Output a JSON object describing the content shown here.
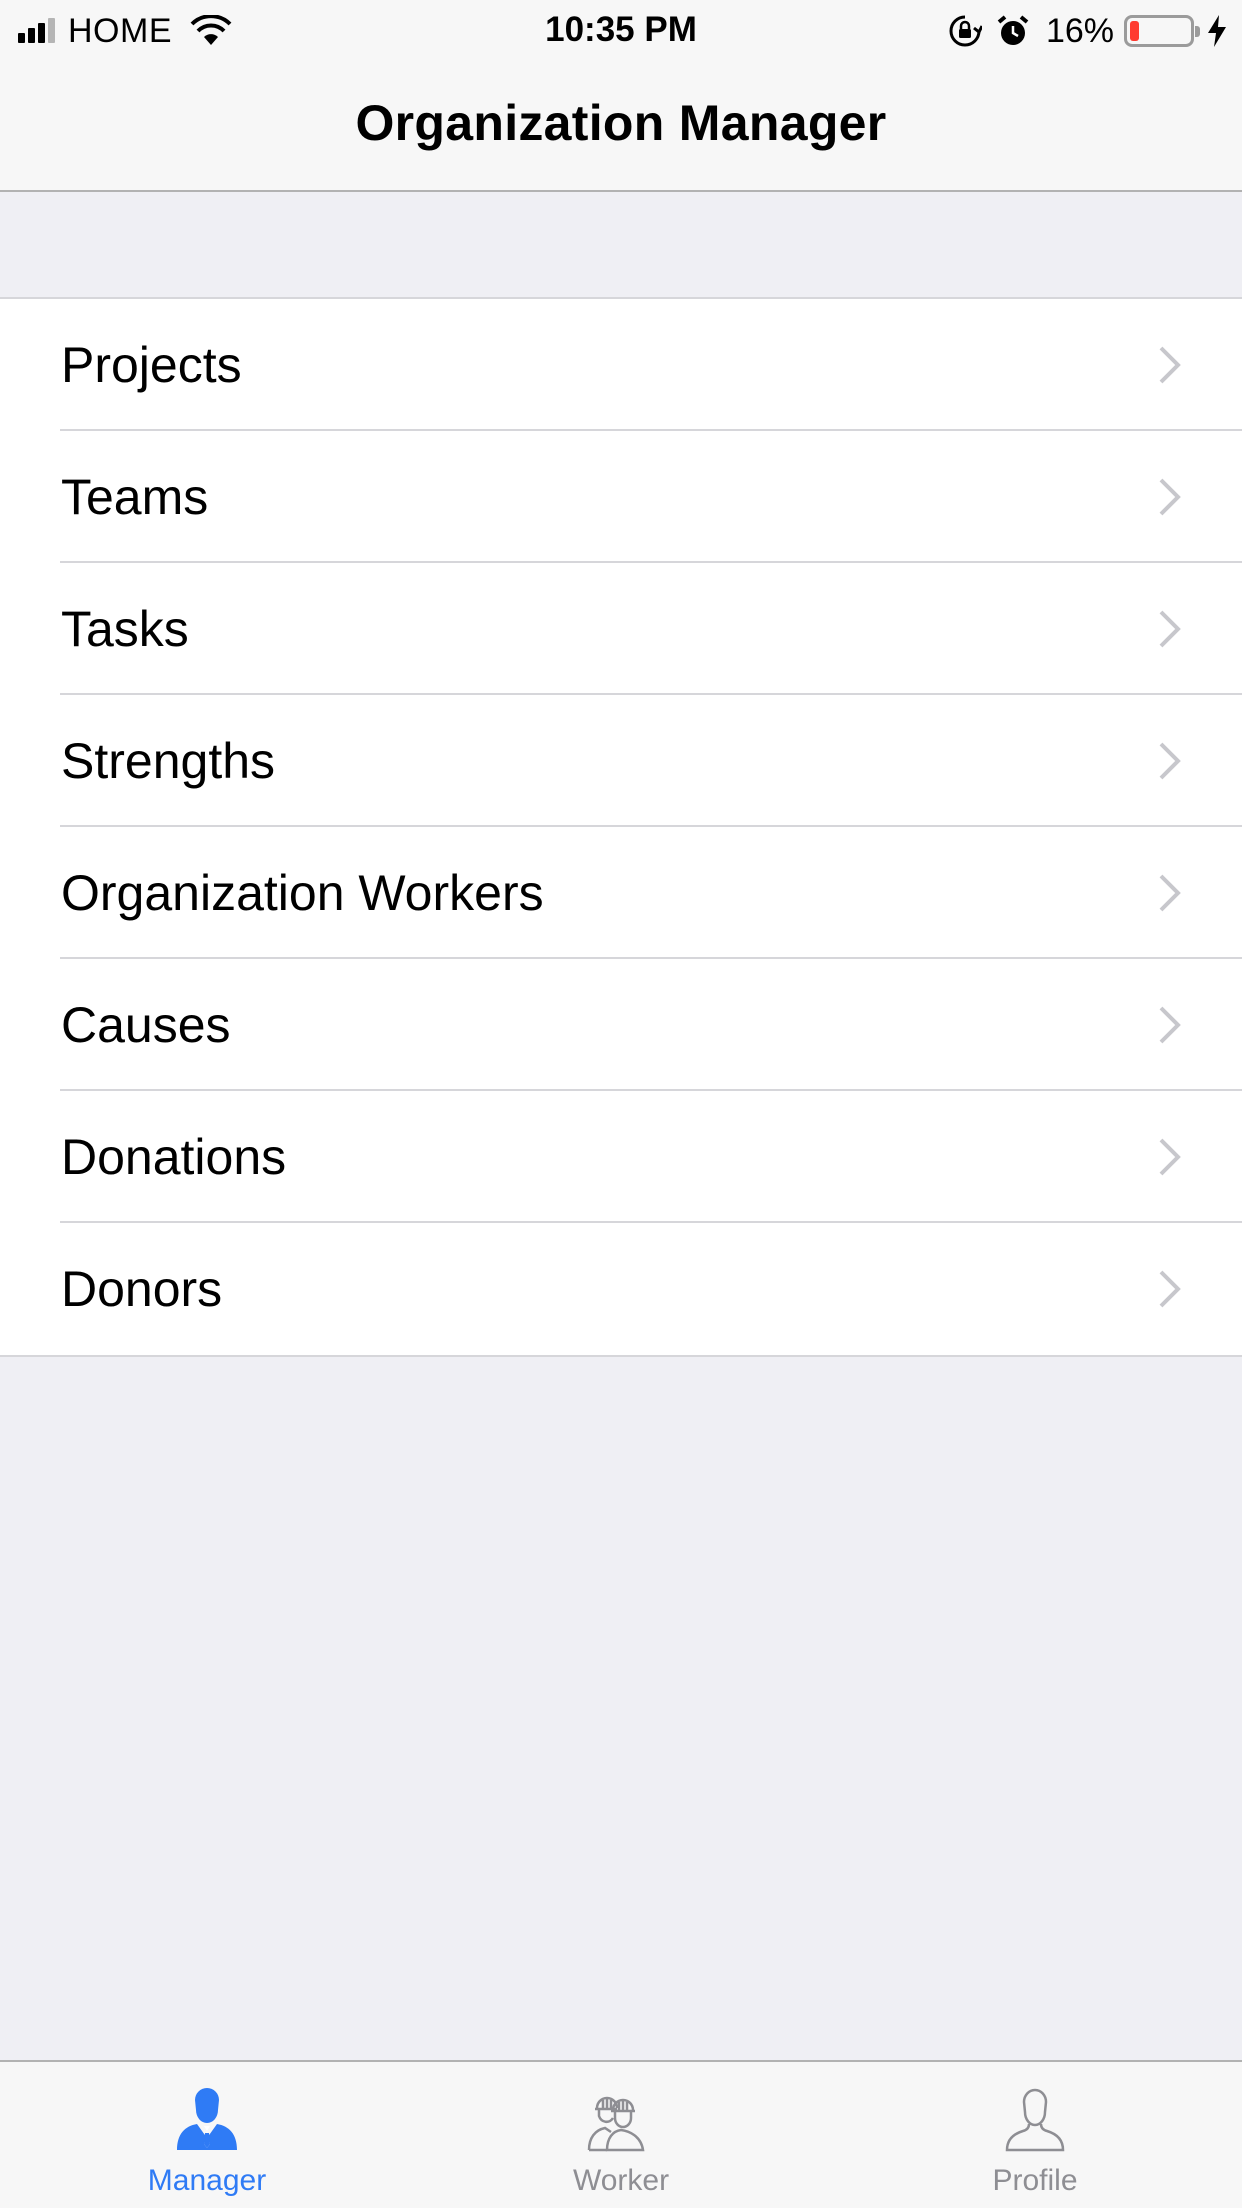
{
  "status_bar": {
    "carrier": "HOME",
    "time": "10:35 PM",
    "battery_percent": "16%",
    "battery_level": 0.16,
    "battery_color": "#ff3b30"
  },
  "nav": {
    "title": "Organization Manager"
  },
  "list": {
    "items": [
      {
        "label": "Projects"
      },
      {
        "label": "Teams"
      },
      {
        "label": "Tasks"
      },
      {
        "label": "Strengths"
      },
      {
        "label": "Organization Workers"
      },
      {
        "label": "Causes"
      },
      {
        "label": "Donations"
      },
      {
        "label": "Donors"
      }
    ]
  },
  "tab_bar": {
    "active_color": "#2f7bf5",
    "inactive_color": "#8e8e93",
    "tabs": [
      {
        "label": "Manager",
        "icon": "manager-icon",
        "active": true
      },
      {
        "label": "Worker",
        "icon": "worker-icon",
        "active": false
      },
      {
        "label": "Profile",
        "icon": "profile-icon",
        "active": false
      }
    ]
  }
}
